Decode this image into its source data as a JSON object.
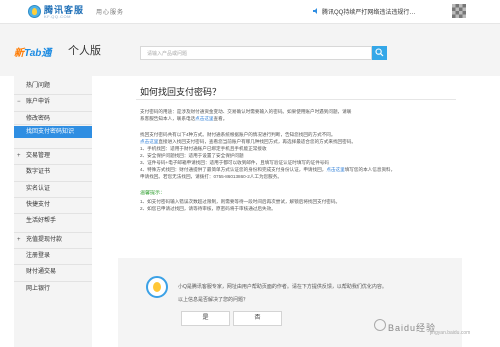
{
  "header": {
    "logo_text": "腾讯客服",
    "logo_sub": "KF.QQ.COM",
    "brand": "用心服务",
    "notice": "腾讯QQ持续严打网络违法违规行…"
  },
  "section": {
    "logo_a": "新",
    "logo_b": "Tab通",
    "title": "个人版"
  },
  "search": {
    "placeholder": "请输入产品或问题"
  },
  "sidebar": {
    "items": [
      {
        "label": "热门问题",
        "kind": "item"
      },
      {
        "label": "账户申诉",
        "kind": "cat",
        "mark": "−"
      },
      {
        "label": "修改密码",
        "kind": "item"
      },
      {
        "label": "找回支付密码知识",
        "kind": "active"
      },
      {
        "label": "交易管理",
        "kind": "cat",
        "mark": "+"
      },
      {
        "label": "数字证书",
        "kind": "item"
      },
      {
        "label": "实名认证",
        "kind": "item"
      },
      {
        "label": "快捷支付",
        "kind": "item"
      },
      {
        "label": "生活好帮手",
        "kind": "item"
      },
      {
        "label": "充值提现付款",
        "kind": "cat",
        "mark": "+"
      },
      {
        "label": "注册登录",
        "kind": "item"
      },
      {
        "label": "财付通交易",
        "kind": "item"
      },
      {
        "label": "网上银行",
        "kind": "item"
      }
    ]
  },
  "article": {
    "title": "如何找回支付密码？",
    "p1": "支付密码的用途：是涉及财付通资金变动、交易确认时需要输入的密码。如果使用账户时遇到问题，请联",
    "p2": "系客服告知本人，联系电话",
    "p2_link": "点击这里",
    "p2_tail": "查看。",
    "p3": "找回支付密码共有以下4种方式。财付通系统根据账户的情况进行判断，告知您找回的方式不同。",
    "p4_link": "点击这里",
    "p4": "直接进入找回支付密码，查看您当前账户有哪几种找回方式，再选择最适合您的方式来找回密码。",
    "list": [
      "1、手机找回：适用于财付通账户已绑定手机且手机能正常接收",
      "2、安全保护问题找回：适用于设置了安全保护问题",
      "3、证件号码+电子邮箱申请找回：适用于都可以收到邮件，且填写验证认证时填写的证件号码",
      "4、特殊方式找回：财付通提供了最简单方式认证您的身份和完成支付身份认证，申请找回，"
    ],
    "list4_link": "点击这里",
    "list4_tail": "填写您的本人信息资料，",
    "list5": "申请找回。若您无法找回，请拨打：0755-86013860-2人工为您服务。",
    "tips_title": "温馨提示：",
    "tips": [
      "1、如支付密码输入错误次数超过限制，则需要等待一段时间后再次尝试，解锁后将找回支付密码。",
      "2、如您已申请过找回，请等待审核，原密码将于审核通过后失效。"
    ]
  },
  "feedback": {
    "line1": "小Q是腾讯客服专家，网址由用户帮助页面的作者。请在下方提供反馈，以帮助我们优化内容。",
    "line2": "以上信息是否解决了您的问题？",
    "yes": "是",
    "no": "否"
  },
  "watermark": {
    "text": "Baidu经验",
    "sub": "jingyan.baidu.com"
  }
}
